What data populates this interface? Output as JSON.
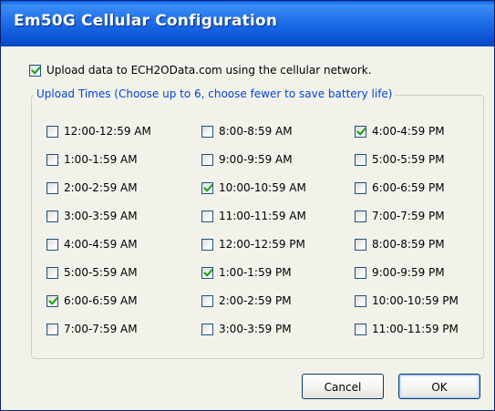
{
  "window": {
    "title": "Em50G Cellular Configuration"
  },
  "upload": {
    "label": "Upload data to ECH2OData.com using the cellular network.",
    "checked": true
  },
  "group": {
    "legend": "Upload Times (Choose up to 6, choose fewer to save battery life)"
  },
  "slots": [
    {
      "label": "12:00-12:59 AM",
      "checked": false
    },
    {
      "label": "1:00-1:59 AM",
      "checked": false
    },
    {
      "label": "2:00-2:59 AM",
      "checked": false
    },
    {
      "label": "3:00-3:59 AM",
      "checked": false
    },
    {
      "label": "4:00-4:59 AM",
      "checked": false
    },
    {
      "label": "5:00-5:59 AM",
      "checked": false
    },
    {
      "label": "6:00-6:59 AM",
      "checked": true
    },
    {
      "label": "7:00-7:59 AM",
      "checked": false
    },
    {
      "label": "8:00-8:59 AM",
      "checked": false
    },
    {
      "label": "9:00-9:59 AM",
      "checked": false
    },
    {
      "label": "10:00-10:59 AM",
      "checked": true
    },
    {
      "label": "11:00-11:59 AM",
      "checked": false
    },
    {
      "label": "12:00-12:59 PM",
      "checked": false
    },
    {
      "label": "1:00-1:59 PM",
      "checked": true
    },
    {
      "label": "2:00-2:59 PM",
      "checked": false
    },
    {
      "label": "3:00-3:59 PM",
      "checked": false
    },
    {
      "label": "4:00-4:59 PM",
      "checked": true
    },
    {
      "label": "5:00-5:59 PM",
      "checked": false
    },
    {
      "label": "6:00-6:59 PM",
      "checked": false
    },
    {
      "label": "7:00-7:59 PM",
      "checked": false
    },
    {
      "label": "8:00-8:59 PM",
      "checked": false
    },
    {
      "label": "9:00-9:59 PM",
      "checked": false
    },
    {
      "label": "10:00-10:59 PM",
      "checked": false
    },
    {
      "label": "11:00-11:59 PM",
      "checked": false
    }
  ],
  "buttons": {
    "cancel_label": "Cancel",
    "ok_label": "OK"
  },
  "colors": {
    "titlebar": "#0c55d8",
    "checkmark": "#21a121",
    "group_legend": "#0046d5",
    "dialog_background": "#f3f2ea"
  },
  "icons": {
    "checkmark": "checkmark-icon"
  }
}
